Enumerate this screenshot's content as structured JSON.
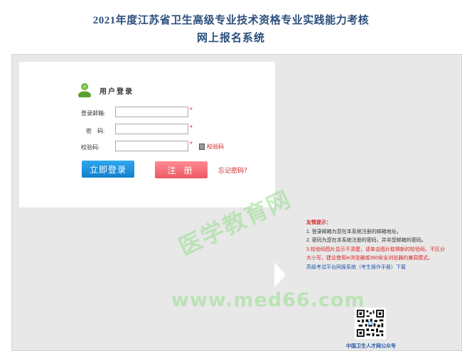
{
  "header": {
    "title_line1": "2021年度江苏省卫生高级专业技术资格专业实践能力考核",
    "title_line2": "网上报名系统"
  },
  "login": {
    "heading": "用户登录",
    "email_label": "登录邮箱:",
    "email_value": "",
    "password_label": "密　码:",
    "password_value": "",
    "captcha_label": "校验码:",
    "captcha_value": "",
    "required_mark": "*",
    "captcha_link": "校验码",
    "login_button": "立即登录",
    "register_button": "注 册",
    "forgot_link": "忘记密码？"
  },
  "tips": {
    "title": "友情提示：",
    "tip1": "1. 登录邮箱为您在本系统注册的邮箱地址。",
    "tip2": "2. 密码为您在本系统注册的密码，并非您邮箱的密码。",
    "tip3": "3.校验码图片显示不清楚，请单击图片取得新的校验码，不区分大小写，建议使用ie浏览器或360安全浏览器的兼容模式。",
    "manual_link": "高级考试平台网报系统（考生操作手册）下载"
  },
  "qr": {
    "caption": "中国卫生人才网公众号"
  },
  "watermark": {
    "text_cn": "医学教育网",
    "url": "www.med66.com"
  },
  "colors": {
    "title": "#2c4f7c",
    "login_button": "#1a8fde",
    "register_button": "#f3707a",
    "alert_red": "#e02020",
    "link_blue": "#2356a8"
  },
  "icons": {
    "user": "user-icon",
    "captcha": "captcha-image-icon",
    "arrow": "arrow-right-icon",
    "qr": "qr-code-icon"
  }
}
